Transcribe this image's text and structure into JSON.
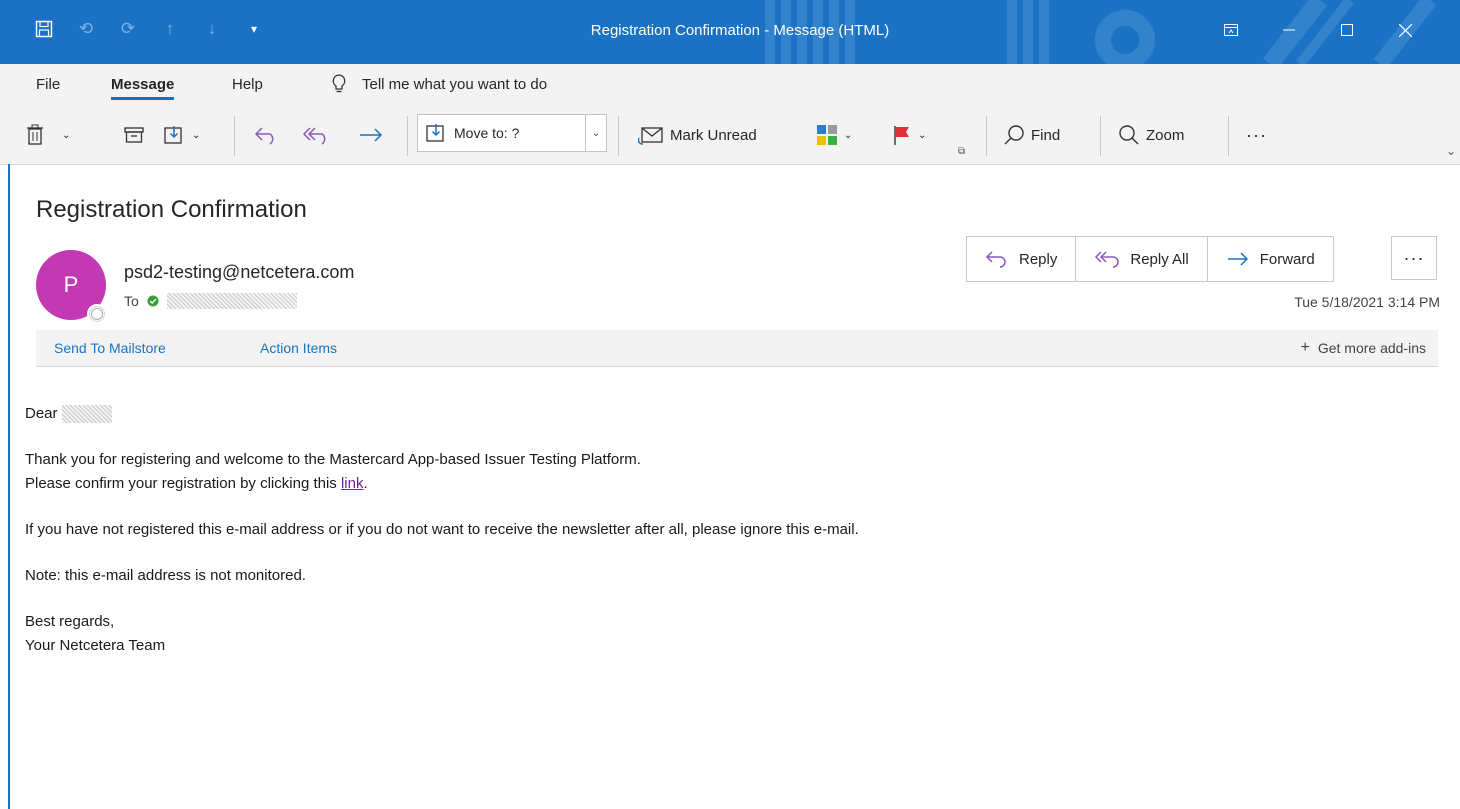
{
  "window": {
    "title": "Registration Confirmation  -  Message (HTML)"
  },
  "menu": {
    "file": "File",
    "message": "Message",
    "help": "Help",
    "tell_me": "Tell me what you want to do"
  },
  "ribbon": {
    "move_to": "Move to: ?",
    "mark_unread": "Mark Unread",
    "find": "Find",
    "zoom": "Zoom",
    "more": "···"
  },
  "message": {
    "subject": "Registration Confirmation",
    "avatar_initial": "P",
    "sender": "psd2-testing@netcetera.com",
    "to_label": "To",
    "date": "Tue 5/18/2021 3:14 PM"
  },
  "actions": {
    "reply": "Reply",
    "reply_all": "Reply All",
    "forward": "Forward",
    "more": "···"
  },
  "addins": {
    "send_to_mailstore": "Send To Mailstore",
    "action_items": "Action Items",
    "get_more": "Get more add-ins"
  },
  "body": {
    "greeting": "Dear",
    "line1": "Thank you for registering and welcome to the Mastercard App-based Issuer Testing Platform.",
    "line2_prefix": "Please confirm your registration by clicking this",
    "link_text": "link",
    "line2_suffix": ".",
    "line3": "If you have not registered this e-mail address or if you do not want to receive the newsletter after all, please ignore this e-mail.",
    "line4": "Note: this e-mail address is not monitored.",
    "sign1": "Best regards,",
    "sign2": "Your Netcetera Team"
  },
  "colors": {
    "accent": "#1b72c4",
    "avatar": "#c239b3",
    "link": "#7a1f9c"
  }
}
